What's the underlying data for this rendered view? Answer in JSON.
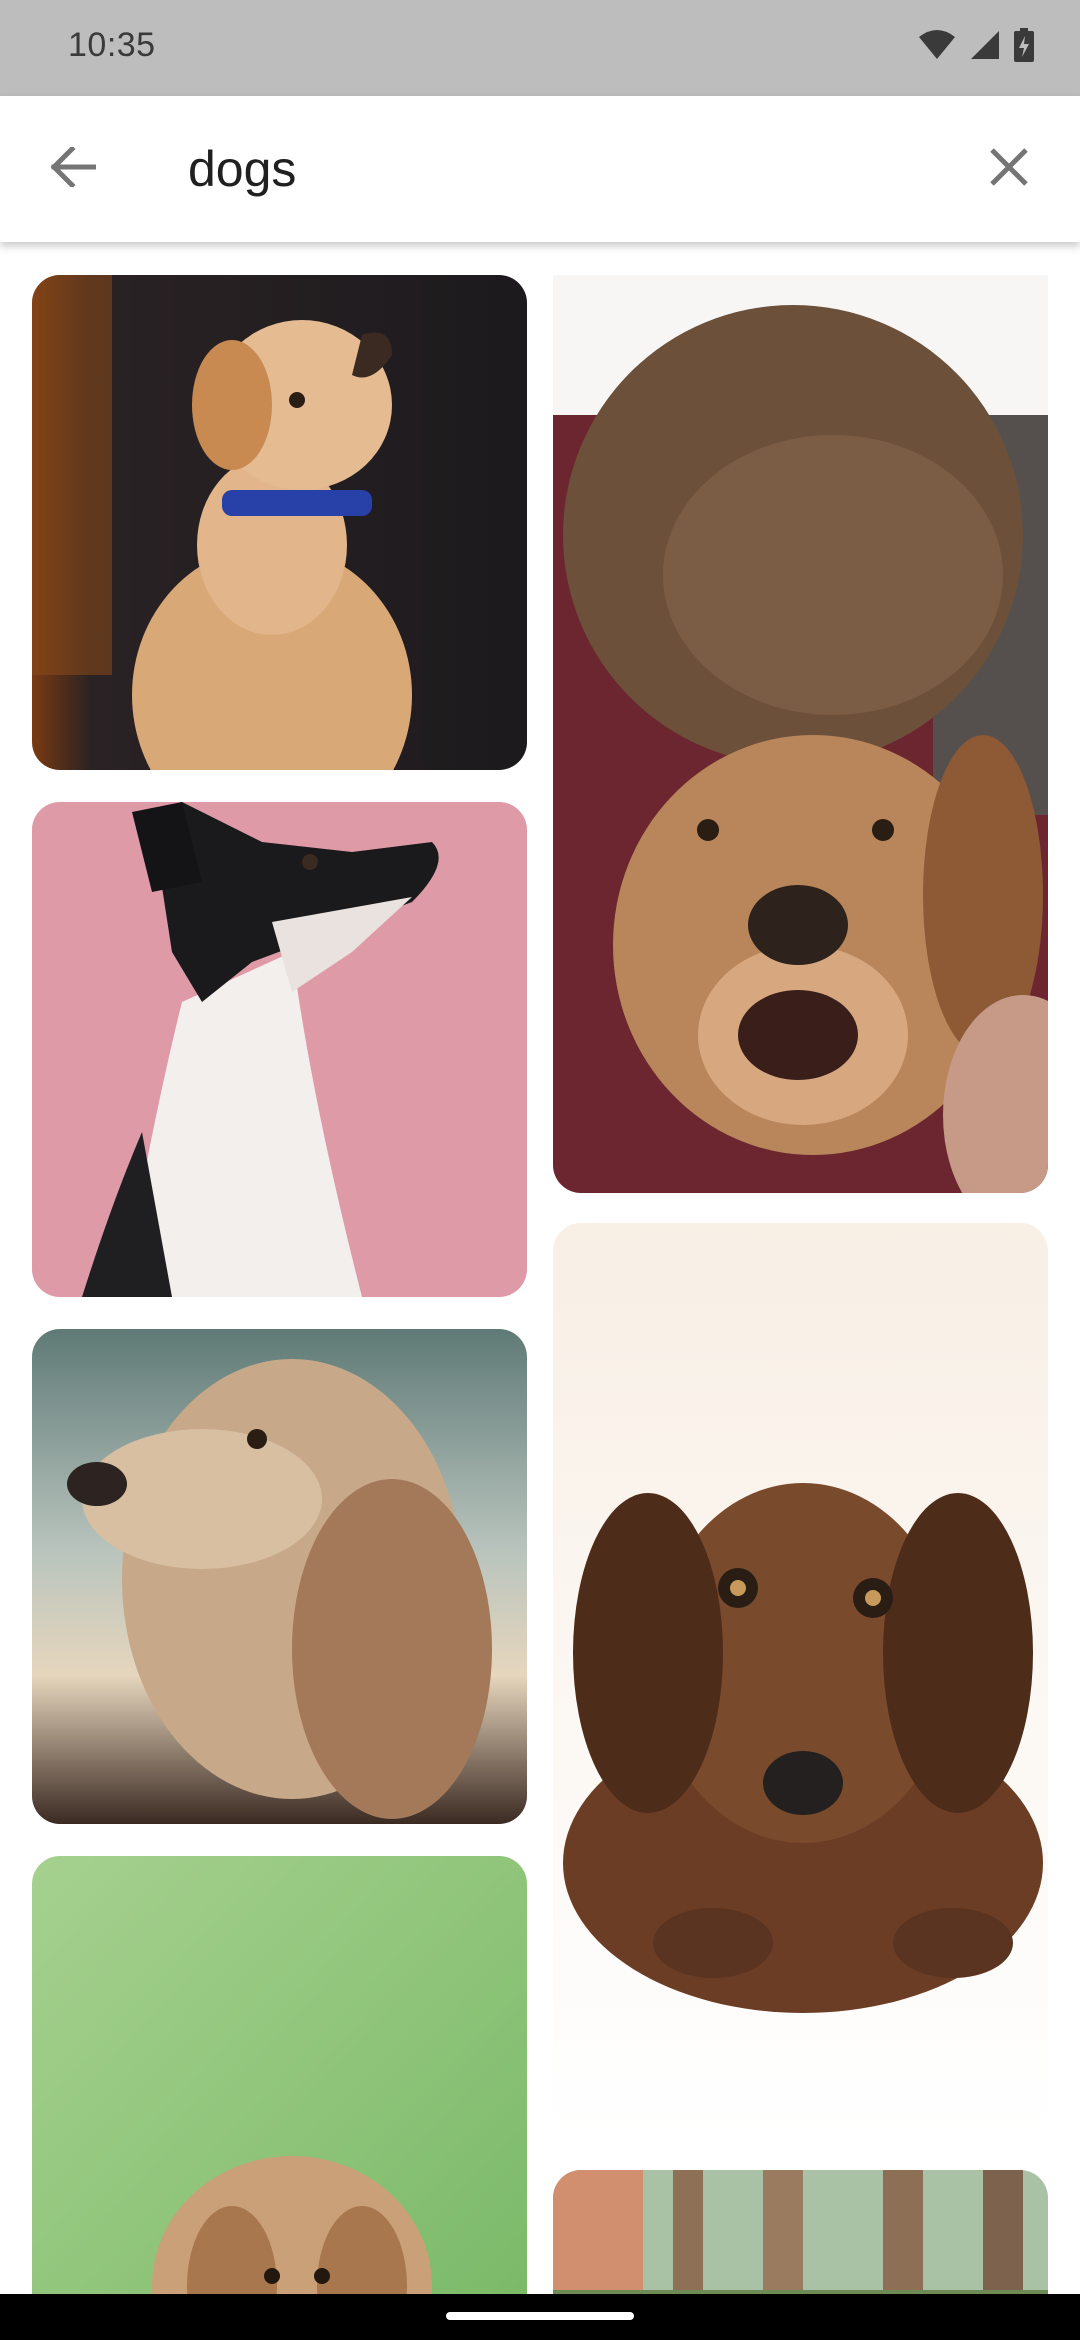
{
  "status_bar": {
    "time": "10:35",
    "icons": [
      "wifi-icon",
      "cellular-signal-icon",
      "battery-charging-icon"
    ]
  },
  "search": {
    "query": "dogs",
    "back_icon": "arrow-back-icon",
    "clear_icon": "close-icon"
  },
  "results": [
    {
      "id": "yellow-lab-puppy-blue-collar",
      "column": "left"
    },
    {
      "id": "black-white-dog-pink-background",
      "column": "left"
    },
    {
      "id": "cocker-spaniel-profile",
      "column": "left"
    },
    {
      "id": "small-fluffy-dog-green-background",
      "column": "left"
    },
    {
      "id": "man-hugging-golden-retriever",
      "column": "right"
    },
    {
      "id": "dachshund-lying-down",
      "column": "right"
    },
    {
      "id": "outdoor-blurred-photo",
      "column": "right"
    }
  ],
  "colors": {
    "status_bar_bg": "#bdbdbd",
    "app_bar_bg": "#ffffff",
    "icon_gray": "#757575",
    "nav_bar_bg": "#000000"
  }
}
